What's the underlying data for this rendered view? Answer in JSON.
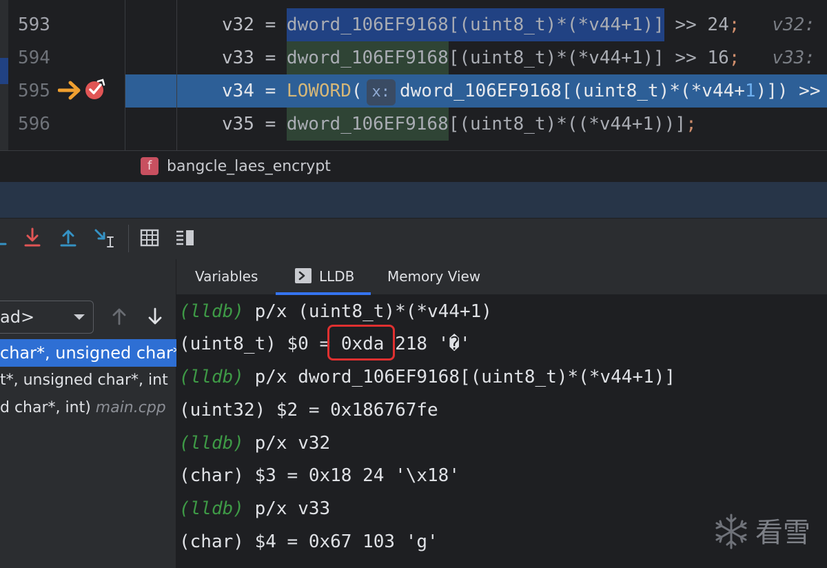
{
  "editor": {
    "lines": [
      {
        "num": "593",
        "lhs": "v32 = ",
        "expr": "dword_106EF9168[(uint8_t)*(*v44+1)]",
        "rest": " >> 24",
        "semi": ";",
        "comment": "   v32:"
      },
      {
        "num": "594",
        "lhs": "v33 = ",
        "expr": "dword_106EF9168",
        "rest": "[(uint8_t)*(*v44+1)] >> 16",
        "semi": ";",
        "comment": "   v33:"
      },
      {
        "num": "595",
        "lhs": "v34 = ",
        "func": "LOWORD",
        "open": "(",
        "inlay": "x:",
        "expr": "dword_106EF9168[(uint8_t)*(*v44+",
        "one": "1",
        "rest": ")]) >>"
      },
      {
        "num": "596",
        "lhs": "v35 = ",
        "expr": "dword_106EF9168",
        "rest": "[(uint8_t)*((*v44+1))]",
        "semi": ";"
      }
    ],
    "breadcrumb": {
      "badge": "f",
      "function": "bangcle_laes_encrypt"
    }
  },
  "frames": {
    "thread": "ad>",
    "items": [
      {
        "text": "char*, unsigned char*",
        "file": ""
      },
      {
        "text": "t*, unsigned char*, int",
        "file": ""
      },
      {
        "text": "d char*, int) ",
        "file": "main.cpp"
      }
    ]
  },
  "tabs": [
    "Variables",
    "LLDB",
    "Memory View"
  ],
  "console": {
    "prompt": "(lldb)",
    "lines": [
      {
        "type": "cmd",
        "text": " p/x (uint8_t)*(*v44+1)"
      },
      {
        "type": "out",
        "pre": "(uint8_t) $0 = ",
        "hex": "0xda",
        "post": " 218 '�'"
      },
      {
        "type": "cmd",
        "text": " p/x dword_106EF9168[(uint8_t)*(*v44+1)]"
      },
      {
        "type": "out",
        "text": "(uint32) $2 = 0x186767fe"
      },
      {
        "type": "cmd",
        "text": " p/x v32"
      },
      {
        "type": "out",
        "text": "(char) $3 = 0x18 24 '\\x18'"
      },
      {
        "type": "cmd",
        "text": " p/x v33"
      },
      {
        "type": "out",
        "text": "(char) $4 = 0x67 103 'g'"
      }
    ]
  },
  "watermark": {
    "text": "看雪"
  },
  "colors": {
    "accent": "#3574f0",
    "selection": "#214283",
    "exec_line": "#2d5f97",
    "prompt": "#3e9a46",
    "highlight": "#e03030"
  }
}
